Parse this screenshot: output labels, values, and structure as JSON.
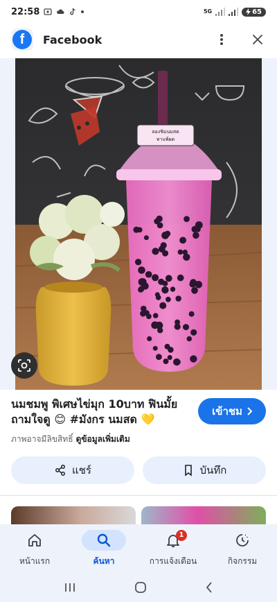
{
  "status_bar": {
    "time": "22:58",
    "network": "5G",
    "battery": "65"
  },
  "header": {
    "app_logo": "f",
    "title": "Facebook",
    "menu_icon": "more-vert-icon",
    "close_icon": "close-icon"
  },
  "result": {
    "title": "นมชมพู พิเศษไข่มุก 10บาท ฟินมั้ย ถามใจดู 😊 #มังกร นมสด 💛",
    "source_name": "ภาพอาจมีลิขสิทธิ์",
    "more_info": "ดูข้อมูลเพิ่มเติม",
    "visit_label": "เข้าชม",
    "cup_label_line1": "ลองชิมนมสด",
    "cup_label_line2": "ทาแพ้ผด"
  },
  "actions": {
    "share_label": "แชร์",
    "save_label": "บันทึก"
  },
  "bottom_nav": {
    "items": [
      {
        "label": "หน้าแรก",
        "icon": "home-icon"
      },
      {
        "label": "ค้นหา",
        "icon": "search-icon",
        "active": true
      },
      {
        "label": "การแจ้งเตือน",
        "icon": "bell-icon",
        "badge": "1"
      },
      {
        "label": "กิจกรรม",
        "icon": "activity-icon"
      }
    ]
  },
  "colors": {
    "accent": "#1a73e8",
    "facebook_blue": "#1877f2",
    "nav_bg": "#eef3fb",
    "active_pill": "#d3e3fd",
    "badge": "#d93025"
  }
}
